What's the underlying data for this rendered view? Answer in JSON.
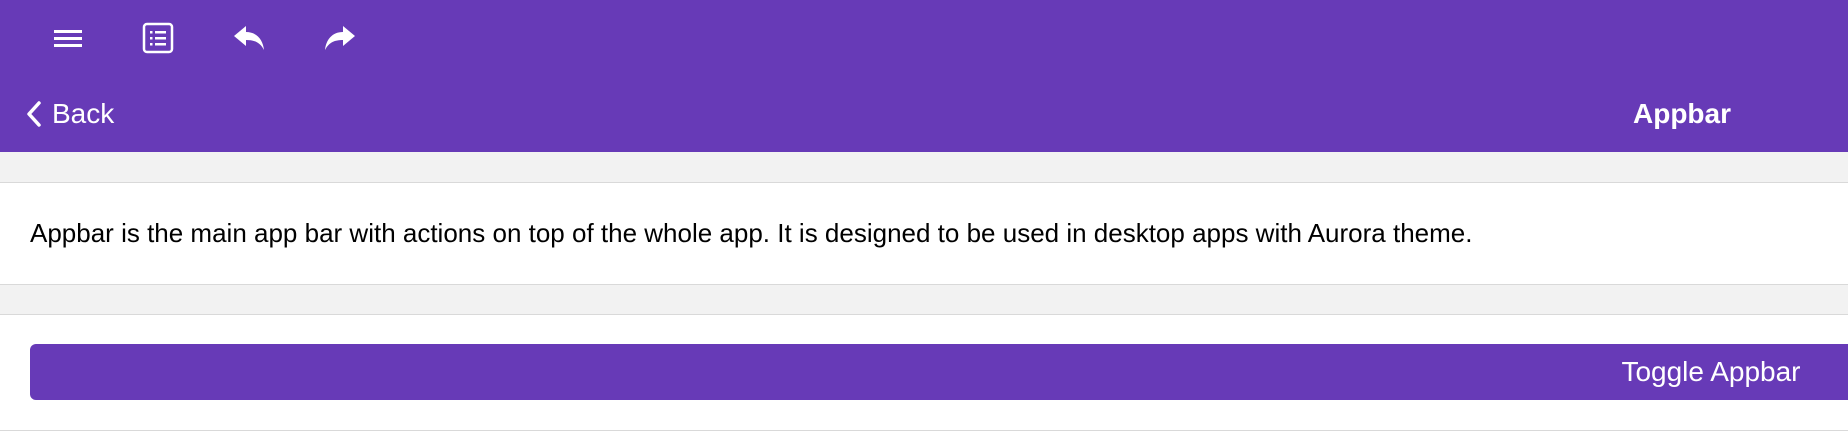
{
  "theme": {
    "accent": "#673ab7",
    "background": "#f2f2f2"
  },
  "appbar": {
    "icons": [
      "menu-icon",
      "list-icon",
      "undo-icon",
      "redo-icon"
    ]
  },
  "navbar": {
    "back_label": "Back",
    "title": "Appbar"
  },
  "content": {
    "description": "Appbar is the main app bar with actions on top of the whole app. It is designed to be used in desktop apps with Aurora theme.",
    "toggle_label": "Toggle Appbar"
  }
}
